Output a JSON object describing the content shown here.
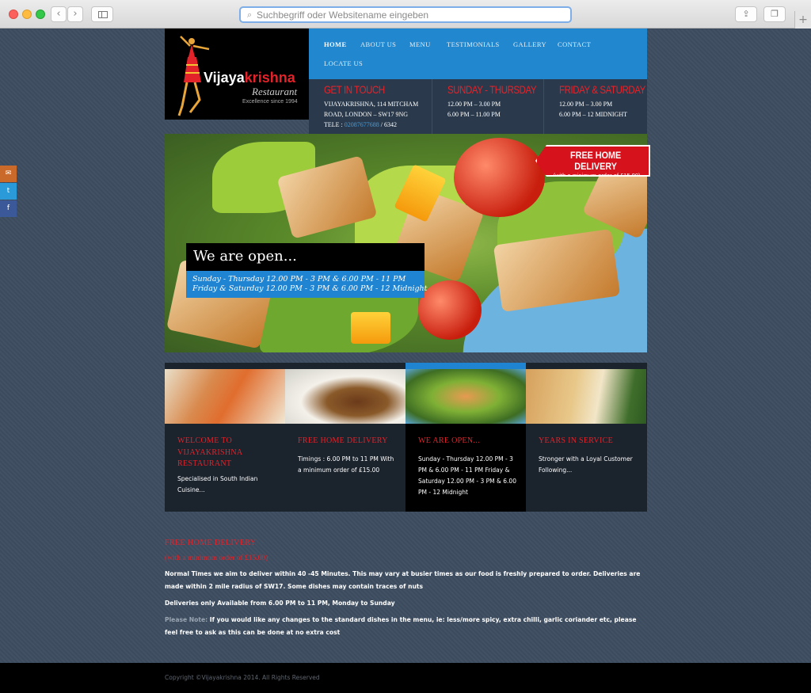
{
  "browser": {
    "url_placeholder": "Suchbegriff oder Websitename eingeben",
    "back_glyph": "‹",
    "forward_glyph": "›",
    "share_glyph": "⇪",
    "tabs_glyph": "❐",
    "newtab_glyph": "+"
  },
  "social": {
    "mail": "✉",
    "twitter": "t",
    "facebook": "f"
  },
  "logo": {
    "brand_first": "Vijaya",
    "brand_second": "krishna",
    "subtitle": "Restaurant",
    "established": "Excellence since 1994"
  },
  "nav": {
    "items": [
      {
        "label": "HOME",
        "active": true
      },
      {
        "label": "ABOUT US"
      },
      {
        "label": "MENU"
      },
      {
        "label": "TESTIMONIALS"
      },
      {
        "label": "GALLERY"
      },
      {
        "label": "CONTACT"
      },
      {
        "label": "LOCATE US"
      }
    ]
  },
  "contact": {
    "title": "GET IN TOUCH",
    "address_line1": "VIJAYAKRISHNA, 114 MITCHAM",
    "address_line2": "ROAD, LONDON – SW17 9NG",
    "tel_label": "TELE :",
    "tel_number": "02087677688",
    "tel_ext": "/ 6342"
  },
  "hours_weekday": {
    "title": "SUNDAY - THURSDAY",
    "line1": "12.00 PM – 3.00 PM",
    "line2": "6.00 PM – 11.00 PM"
  },
  "hours_weekend": {
    "title": "FRIDAY & SATURDAY",
    "line1": "12.00 PM – 3.00 PM",
    "line2": "6.00 PM – 12 MIDNIGHT"
  },
  "hero": {
    "open_title": "We are open...",
    "open_line1": "Sunday - Thursday 12.00 PM - 3 PM & 6.00 PM - 11 PM",
    "open_line2": "Friday & Saturday 12.00 PM - 3 PM & 6.00 PM - 12 Midnight",
    "badge_title": "FREE HOME DELIVERY",
    "badge_sub": "(with a minimum order of £15.00)"
  },
  "features": [
    {
      "title": "WELCOME TO VIJAYAKRISHNA RESTAURANT",
      "text": "Specialised in South Indian Cuisine..."
    },
    {
      "title": "FREE HOME DELIVERY",
      "text": "Timings : 6.00 PM to 11 PM With a minimum order of £15.00"
    },
    {
      "title": "WE ARE OPEN...",
      "text": "Sunday - Thursday 12.00 PM - 3 PM & 6.00 PM - 11 PM Friday & Saturday 12.00 PM - 3 PM & 6.00 PM - 12 Midnight",
      "active": true
    },
    {
      "title": "YEARS IN SERVICE",
      "text": "Stronger with a Loyal Customer Following..."
    }
  ],
  "info": {
    "title": "FREE HOME DELIVERY",
    "subtitle": "(with a minimum order of £15.00)",
    "para1": "Normal Times we aim to deliver within 40 -45 Minutes. This may vary at busier times as our food is freshly prepared to order. Deliveries are made within 2 mile radius of SW17. Some dishes may contain traces of nuts",
    "para2": "Deliveries only Available from 6.00 PM to 11 PM, Monday to Sunday",
    "note_label": "Please Note:",
    "note_text": " If you would like any changes to the standard dishes in the menu, ie: less/more spicy, extra chilli, garlic coriander etc, please feel free to ask as this can be done at no extra cost"
  },
  "footer": {
    "copyright": "Copyright ©Vijayakrishna 2014. All Rights Reserved"
  },
  "colors": {
    "accent_red": "#e3232a",
    "nav_blue": "#2187cf",
    "background": "#3d4d60"
  }
}
